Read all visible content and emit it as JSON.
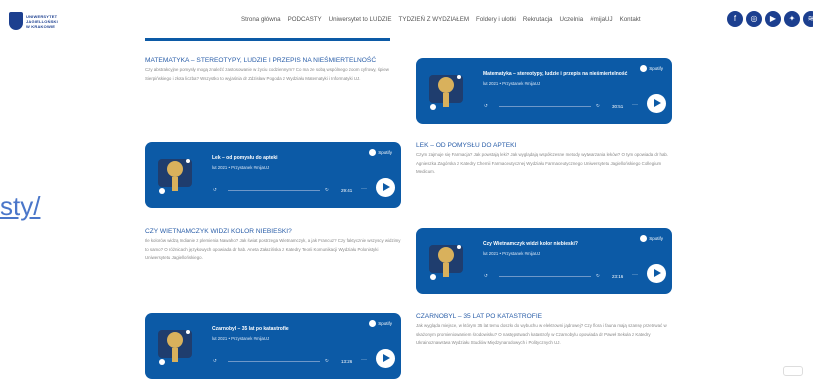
{
  "logo": {
    "lines": [
      "UNIWERSYTET",
      "JAGIELLOŃSKI",
      "W KRAKOWIE"
    ]
  },
  "nav": [
    "Strona główna",
    "PODCASTY",
    "Uniwersytet to LUDZIE",
    "TYDZIEŃ Z WYDZIAŁEM",
    "Foldery i ulotki",
    "Rekrutacja",
    "Uczelnia",
    "#mijaUJ",
    "Kontakt"
  ],
  "social_icons": [
    "facebook-icon",
    "instagram-icon",
    "youtube-icon",
    "twitter-icon",
    "spotify-icon"
  ],
  "side_link": "sty/",
  "podcasts": [
    {
      "heading": "MATEMATYKA – STEREOTYPY, LUDZIE I PRZEPIS NA NIEŚMIERTELNOŚĆ",
      "description": "Czy abstrakcyjne pomysły mogą znaleźć zastosowanie w życiu codziennym? Co ma ze sobą wspólnego zoom cyfrowy, śpiew Sierpińskiego i złota liczba? Wszystko to wyjaśnia dr Zdzisław Pogoda z Wydziału Matematyki i Informatyki UJ.",
      "card": {
        "title": "Matematyka – stereotypy, ludzie i przepis na nieśmiertelność",
        "meta": "lut 2021 • Przystanek #mijaUJ",
        "duration": "30:51"
      }
    },
    {
      "heading": "LEK – OD POMYSŁU DO APTEKI",
      "description": "Czym zajmuje się Farmacja? Jak powstają leki? Jak wyglądają współczesne metody wytwarzania leków? O tym opowiada dr hab. Agnieszka Zagórska z Katedry Chemii Farmaceutycznej Wydziału Farmaceutycznego Uniwersytetu Jagiellońskiego Collegium Medicum.",
      "card": {
        "title": "Lek – od pomysłu do apteki",
        "meta": "lut 2021 • Przystanek #mijaUJ",
        "duration": "29:41"
      }
    },
    {
      "heading": "CZY WIETNAMCZYK WIDZI KOLOR NIEBIESKI?",
      "description": "Ile kolorów widzą Indianie z plemienia Nawaho? Jak świat postrzega Wietnamczyk, a jak Francuz? Czy faktycznie wszyscy widzimy to samo? O różnicach językowych opowiada dr hab. Aneta Załazińska z Katedry Teorii Komunikacji Wydziału Polonistyki Uniwersytetu Jagiellońskiego.",
      "card": {
        "title": "Czy Wietnamczyk widzi kolor niebieski?",
        "meta": "lut 2021 • Przystanek #mijaUJ",
        "duration": "23:16"
      }
    },
    {
      "heading": "CZARNOBYL – 35 LAT PO KATASTROFIE",
      "description": "Jak wygląda miejsce, w którym 35 lat temu doszło do wybuchu w elektrowni jądrowej? Czy flora i fauna mają szansę przetrwać w skażonym promieniowaniem środowisku? O następstwach katastrofy w Czarnobylu opowiada dr Paweł Sekuła z Katedry Ukrainoznawstwa Wydziału Studiów Międzynarodowych i Politycznych UJ.",
      "card": {
        "title": "Czarnobyl – 35 lat po katastrofie",
        "meta": "lut 2021 • Przystanek #mijaUJ",
        "duration": "13:26"
      }
    }
  ],
  "spotify_label": "Spotify",
  "colors": {
    "brand": "#1c3f8f",
    "card": "#0c5aa6",
    "heading": "#2a5ea8"
  }
}
